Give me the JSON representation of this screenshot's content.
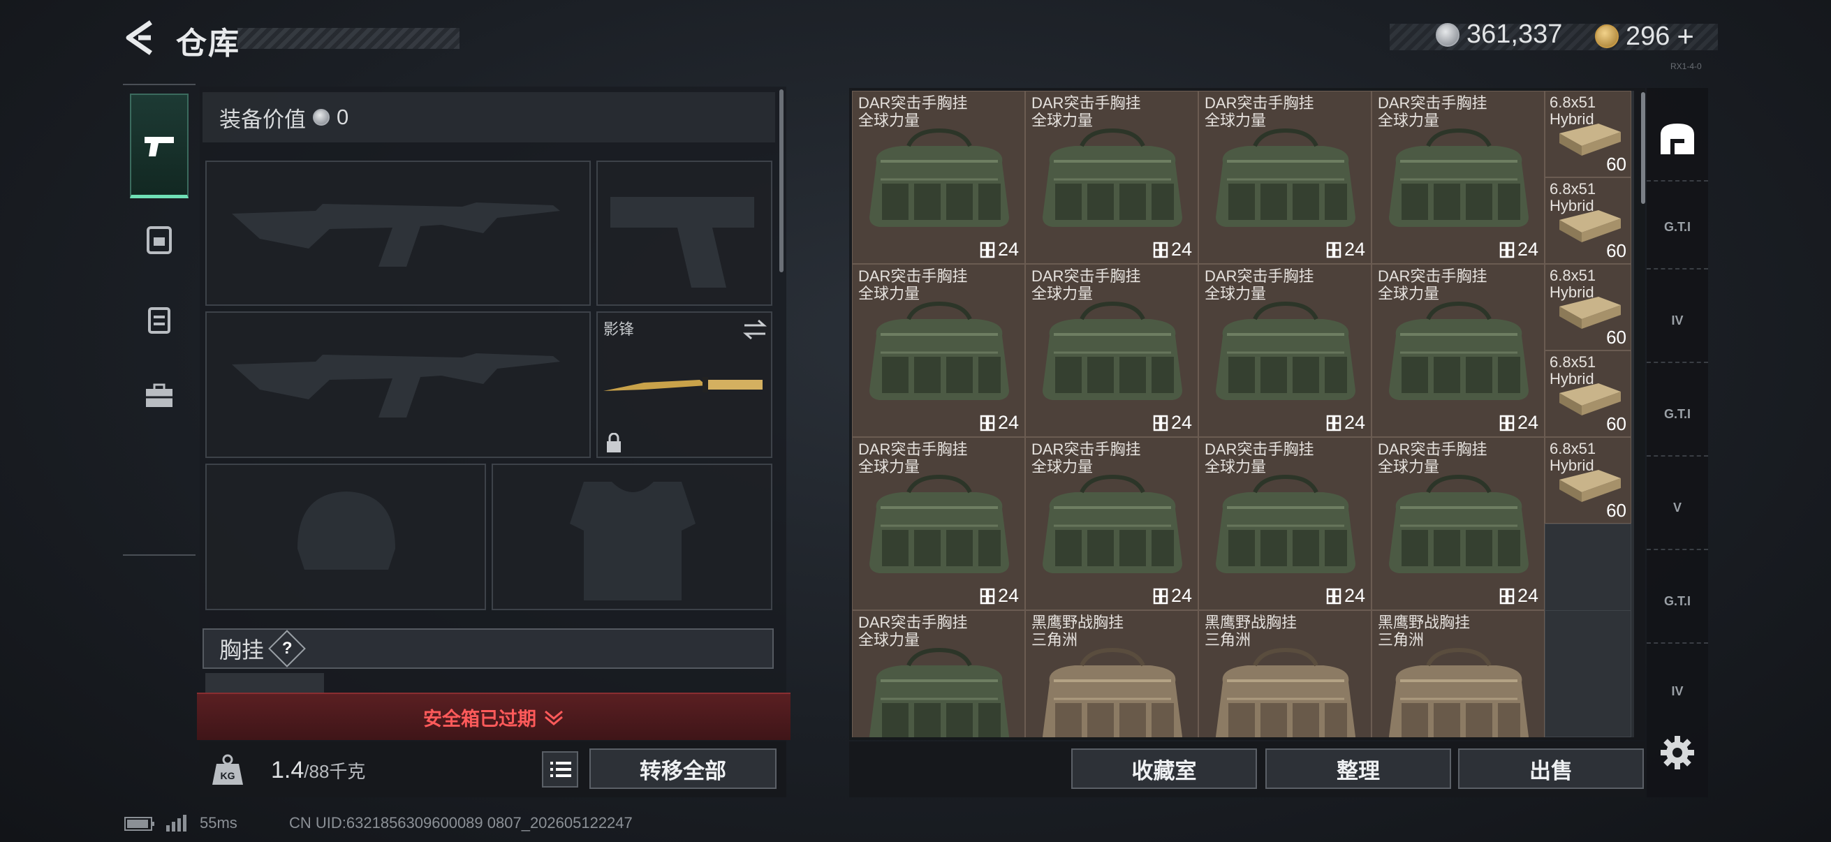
{
  "header": {
    "title": "仓库",
    "currency_silver": "361,337",
    "currency_gold": "296",
    "gold_plus": "+",
    "tiny": "RX1-4-0"
  },
  "equipment": {
    "value_label": "装备价值",
    "value": "0",
    "melee_name": "影锋",
    "chest_label": "胸挂",
    "help": "?",
    "safe_box_expired": "安全箱已过期",
    "weight_current": "1.4",
    "weight_max": "/88千克",
    "transfer_all": "转移全部"
  },
  "warehouse": {
    "dar_name": "DAR突击手胸挂\n全球力量",
    "heiying_name": "黑鹰野战胸挂\n三角洲",
    "bag_count": "24",
    "ammo_name": "6.8x51\nHybrid",
    "ammo_count": "60",
    "collection_room": "收藏室",
    "organize": "整理",
    "sell": "出售"
  },
  "right_nav": {
    "gti": "G.T.I",
    "iv": "IV",
    "v": "V"
  },
  "status": {
    "ping": "55ms",
    "uid": "CN UID:6321856309600089 0807_202605122247"
  },
  "colors": {
    "accent_green": "#6fe0b6",
    "alert_red": "#ff5a5a",
    "cell_brown": "#4d413a"
  }
}
